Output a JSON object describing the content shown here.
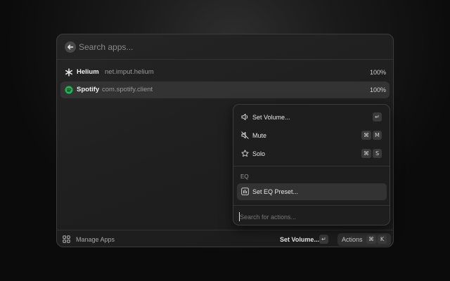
{
  "search": {
    "placeholder": "Search apps..."
  },
  "apps": [
    {
      "name": "Helium",
      "bundle": "net.imput.helium",
      "volume": "100%",
      "icon": "helium-icon"
    },
    {
      "name": "Spotify",
      "bundle": "com.spotify.client",
      "volume": "100%",
      "icon": "spotify-icon",
      "brand_color": "#1DB954"
    }
  ],
  "actions_menu": {
    "items": [
      {
        "label": "Set Volume...",
        "icon": "speaker-icon",
        "shortcut": [
          "↵"
        ]
      },
      {
        "label": "Mute",
        "icon": "speaker-mute-icon",
        "shortcut": [
          "⌘",
          "M"
        ]
      },
      {
        "label": "Solo",
        "icon": "star-icon",
        "shortcut": [
          "⌘",
          "S"
        ]
      }
    ],
    "section_label": "EQ",
    "eq_item": {
      "label": "Set EQ Preset...",
      "icon": "equalizer-icon"
    },
    "search_placeholder": "Search for actions..."
  },
  "footer": {
    "manage_label": "Manage Apps",
    "primary_action_label": "Set Volume...",
    "primary_action_key": "↵",
    "actions_label": "Actions",
    "actions_keys": [
      "⌘",
      "K"
    ]
  }
}
